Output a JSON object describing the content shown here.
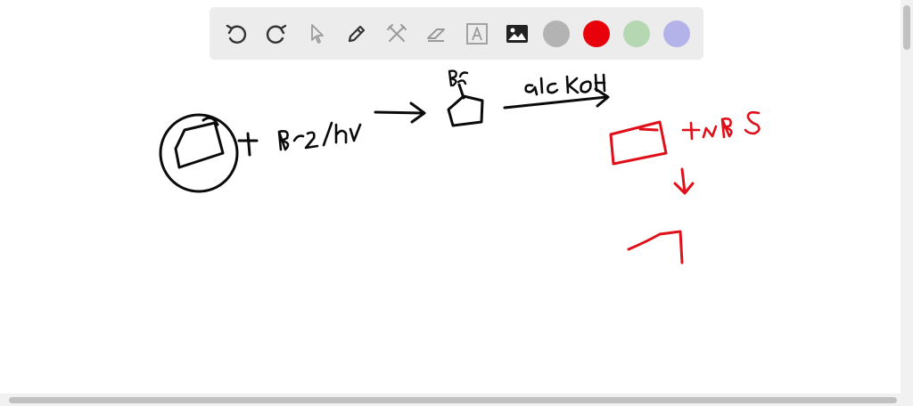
{
  "colors": {
    "black_ink": "#0b0b0b",
    "red_ink": "#e0101a",
    "toolbar_bg": "#ececec",
    "swatches": [
      "#b3b3b3",
      "#e8000b",
      "#b5d8b2",
      "#b3b3ea"
    ]
  },
  "toolbar": {
    "tools": [
      "undo-icon",
      "redo-icon",
      "pointer-icon",
      "pen-icon",
      "tools-icon",
      "eraser-icon",
      "text-icon",
      "image-icon"
    ]
  }
}
